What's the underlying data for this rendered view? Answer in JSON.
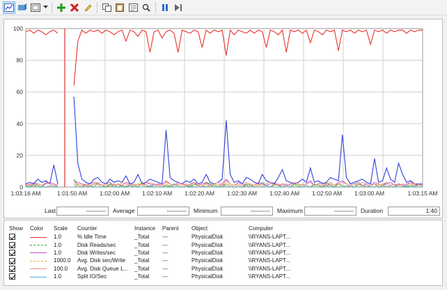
{
  "toolbar": {
    "buttons": [
      "view-graph-icon",
      "view-current-activity-icon",
      "change-graph-type-icon",
      "add-icon",
      "delete-icon",
      "highlight-icon",
      "copy-properties-icon",
      "paste-counter-list-icon",
      "properties-icon",
      "zoom-icon",
      "freeze-display-icon",
      "update-data-icon"
    ]
  },
  "stats": {
    "last_label": "Last",
    "last_value": "----------",
    "average_label": "Average",
    "average_value": "----------",
    "minimum_label": "Minimum",
    "minimum_value": "----------",
    "maximum_label": "Maximum",
    "maximum_value": "----------",
    "duration_label": "Duration",
    "duration_value": "1:40"
  },
  "columns": [
    "Show",
    "Color",
    "Scale",
    "Counter",
    "Instance",
    "Parent",
    "Object",
    "Computer"
  ],
  "counters": [
    {
      "scale": "1.0",
      "counter": "% Idle Time",
      "instance": "_Total",
      "parent": "---",
      "object": "PhysicalDisk",
      "computer": "\\\\RYANS-LAPT...",
      "color": "#e8322f",
      "dashed": false
    },
    {
      "scale": "1.0",
      "counter": "Disk Reads/sec",
      "instance": "_Total",
      "parent": "---",
      "object": "PhysicalDisk",
      "computer": "\\\\RYANS-LAPT...",
      "color": "#2e9e2e",
      "dashed": true
    },
    {
      "scale": "1.0",
      "counter": "Disk Writes/sec",
      "instance": "_Total",
      "parent": "---",
      "object": "PhysicalDisk",
      "computer": "\\\\RYANS-LAPT...",
      "color": "#c04bc0",
      "dashed": false
    },
    {
      "scale": "1000.0",
      "counter": "Avg. Disk sec/Write",
      "instance": "_Total",
      "parent": "---",
      "object": "PhysicalDisk",
      "computer": "\\\\RYANS-LAPT...",
      "color": "#e0b020",
      "dashed": true
    },
    {
      "scale": "100.0",
      "counter": "Avg. Disk Queue L...",
      "instance": "_Total",
      "parent": "---",
      "object": "PhysicalDisk",
      "computer": "\\\\RYANS-LAPT...",
      "color": "#f08a8a",
      "dashed": false
    },
    {
      "scale": "1.0",
      "counter": "Split IO/Sec",
      "instance": "_Total",
      "parent": "---",
      "object": "PhysicalDisk",
      "computer": "\\\\RYANS-LAPT...",
      "color": "#4aa8e0",
      "dashed": false
    }
  ],
  "chart_data": {
    "type": "line",
    "ylim": [
      0,
      100
    ],
    "y_ticks": [
      "0",
      "20",
      "40",
      "60",
      "80",
      "100"
    ],
    "x_ticks": [
      "1:03:16 AM",
      "1:01:50 AM",
      "1:02:00 AM",
      "1:02:10 AM",
      "1:02:20 AM",
      "1:02:30 AM",
      "1:02:40 AM",
      "1:02:50 AM",
      "1:03:00 AM",
      "1:03:15 AM"
    ],
    "grid": true,
    "series": [
      {
        "name": "% Idle Time",
        "color": "#e8322f",
        "values": [
          98,
          99,
          97,
          99,
          98,
          96,
          98,
          99,
          97,
          null,
          null,
          null,
          64,
          92,
          99,
          97,
          99,
          98,
          99,
          97,
          99,
          98,
          96,
          98,
          99,
          92,
          99,
          98,
          95,
          99,
          98,
          85,
          98,
          99,
          94,
          98,
          99,
          97,
          85,
          99,
          98,
          97,
          99,
          98,
          88,
          99,
          97,
          99,
          98,
          99,
          83,
          99,
          96,
          99,
          98,
          97,
          99,
          97,
          99,
          98,
          88,
          99,
          98,
          96,
          99,
          85,
          99,
          98,
          99,
          97,
          99,
          91,
          99,
          98,
          96,
          99,
          98,
          99,
          86,
          99,
          98,
          99,
          97,
          99,
          98,
          99,
          90,
          99,
          98,
          99,
          97,
          99,
          98,
          99,
          99,
          97,
          99,
          98,
          99,
          99
        ]
      },
      {
        "name": "Split IO/Sec",
        "color": "#2f3fd6",
        "values": [
          2,
          3,
          2,
          5,
          3,
          4,
          2,
          14,
          2,
          null,
          null,
          null,
          57,
          15,
          5,
          3,
          2,
          5,
          6,
          3,
          2,
          5,
          3,
          4,
          3,
          7,
          2,
          3,
          8,
          2,
          3,
          5,
          4,
          3,
          2,
          36,
          6,
          4,
          3,
          2,
          4,
          3,
          5,
          2,
          3,
          8,
          3,
          2,
          3,
          5,
          42,
          8,
          3,
          4,
          2,
          6,
          5,
          3,
          2,
          8,
          4,
          3,
          2,
          6,
          11,
          4,
          3,
          2,
          3,
          5,
          3,
          12,
          3,
          4,
          2,
          3,
          6,
          5,
          4,
          33,
          6,
          2,
          3,
          4,
          5,
          3,
          2,
          18,
          3,
          4,
          12,
          5,
          3,
          15,
          8,
          3,
          4,
          2,
          2,
          2
        ]
      },
      {
        "name": "Disk Reads/sec",
        "color": "#2e9e2e",
        "values": [
          1,
          0,
          2,
          1,
          0,
          3,
          2,
          1,
          0,
          null,
          null,
          null,
          5,
          1,
          0,
          2,
          1,
          0,
          3,
          1,
          0,
          2,
          1,
          0,
          1,
          0,
          2,
          1,
          0,
          3,
          1,
          0,
          2,
          1,
          0,
          1,
          0,
          2,
          1,
          0,
          1,
          0,
          2,
          1,
          0,
          3,
          2,
          1,
          0,
          1,
          2,
          1,
          0,
          1,
          0,
          2,
          1,
          0,
          1,
          3,
          1,
          0,
          2,
          1,
          0,
          1,
          0,
          2,
          1,
          0,
          1,
          0,
          2,
          1,
          0,
          3,
          1,
          0,
          2,
          1,
          0,
          1,
          0,
          2,
          1,
          0,
          1,
          2,
          0,
          1,
          3,
          1,
          0,
          2,
          1,
          0,
          1,
          0,
          2,
          1
        ]
      },
      {
        "name": "Disk Writes/sec",
        "color": "#c04bc0",
        "values": [
          2,
          1,
          3,
          2,
          1,
          2,
          3,
          2,
          1,
          null,
          null,
          null,
          4,
          3,
          2,
          1,
          2,
          3,
          2,
          1,
          2,
          3,
          1,
          2,
          1,
          3,
          2,
          1,
          2,
          1,
          3,
          2,
          1,
          2,
          1,
          4,
          2,
          1,
          3,
          2,
          1,
          2,
          3,
          1,
          2,
          3,
          1,
          2,
          1,
          2,
          5,
          2,
          1,
          3,
          2,
          1,
          2,
          1,
          3,
          2,
          1,
          2,
          3,
          1,
          2,
          1,
          2,
          3,
          2,
          1,
          2,
          4,
          1,
          2,
          3,
          1,
          2,
          1,
          3,
          4,
          2,
          1,
          2,
          3,
          1,
          2,
          1,
          3,
          2,
          1,
          2,
          3,
          1,
          2,
          1,
          2,
          3,
          1,
          2,
          1
        ]
      },
      {
        "name": "Avg. Disk sec/Write",
        "color": "#e0b020",
        "values": [
          0,
          1,
          0,
          2,
          1,
          0,
          1,
          0,
          1,
          null,
          null,
          null,
          2,
          1,
          0,
          1,
          0,
          2,
          1,
          0,
          1,
          0,
          1,
          2,
          0,
          1,
          0,
          1,
          2,
          1,
          0,
          1,
          0,
          1,
          0,
          2,
          1,
          0,
          1,
          0,
          1,
          2,
          0,
          1,
          0,
          1,
          0,
          2,
          1,
          0,
          2,
          1,
          0,
          1,
          0,
          1,
          2,
          0,
          1,
          0,
          1,
          0,
          1,
          2,
          0,
          1,
          0,
          1,
          0,
          2,
          1,
          0,
          1,
          0,
          1,
          0,
          2,
          1,
          0,
          1,
          0,
          1,
          2,
          0,
          1,
          0,
          1,
          0,
          2,
          1,
          0,
          1,
          0,
          1,
          0,
          1,
          2,
          0,
          1,
          0
        ]
      },
      {
        "name": "Avg. Disk Queue L...",
        "color": "#f08a8a",
        "values": [
          1,
          2,
          1,
          2,
          1,
          3,
          2,
          1,
          2,
          null,
          null,
          null,
          3,
          2,
          1,
          2,
          1,
          2,
          3,
          1,
          2,
          1,
          2,
          1,
          3,
          2,
          1,
          2,
          1,
          2,
          1,
          3,
          2,
          1,
          2,
          3,
          2,
          1,
          2,
          1,
          2,
          1,
          3,
          2,
          1,
          2,
          1,
          2,
          3,
          1,
          4,
          2,
          1,
          2,
          1,
          3,
          2,
          1,
          2,
          1,
          2,
          3,
          1,
          2,
          1,
          2,
          1,
          3,
          2,
          1,
          2,
          3,
          1,
          2,
          1,
          2,
          3,
          1,
          2,
          3,
          2,
          1,
          2,
          1,
          3,
          2,
          1,
          2,
          1,
          2,
          3,
          1,
          2,
          1,
          2,
          1,
          3,
          2,
          1,
          2
        ]
      },
      {
        "name": "Split IO/Sec",
        "color": "#4aa8e0",
        "values": [
          0,
          0,
          1,
          0,
          0,
          0,
          1,
          0,
          0,
          null,
          null,
          null,
          1,
          0,
          0,
          0,
          1,
          0,
          0,
          0,
          0,
          1,
          0,
          0,
          0,
          0,
          1,
          0,
          0,
          0,
          0,
          1,
          0,
          0,
          0,
          0,
          1,
          0,
          0,
          0,
          0,
          1,
          0,
          0,
          0,
          0,
          1,
          0,
          0,
          0,
          1,
          0,
          0,
          0,
          0,
          1,
          0,
          0,
          0,
          0,
          1,
          0,
          0,
          0,
          0,
          1,
          0,
          0,
          0,
          0,
          1,
          0,
          0,
          0,
          0,
          1,
          0,
          0,
          0,
          0,
          1,
          0,
          0,
          0,
          0,
          1,
          0,
          0,
          0,
          0,
          1,
          0,
          0,
          0,
          0,
          1,
          0,
          0,
          0,
          0
        ]
      }
    ],
    "cursor_index": 9
  }
}
